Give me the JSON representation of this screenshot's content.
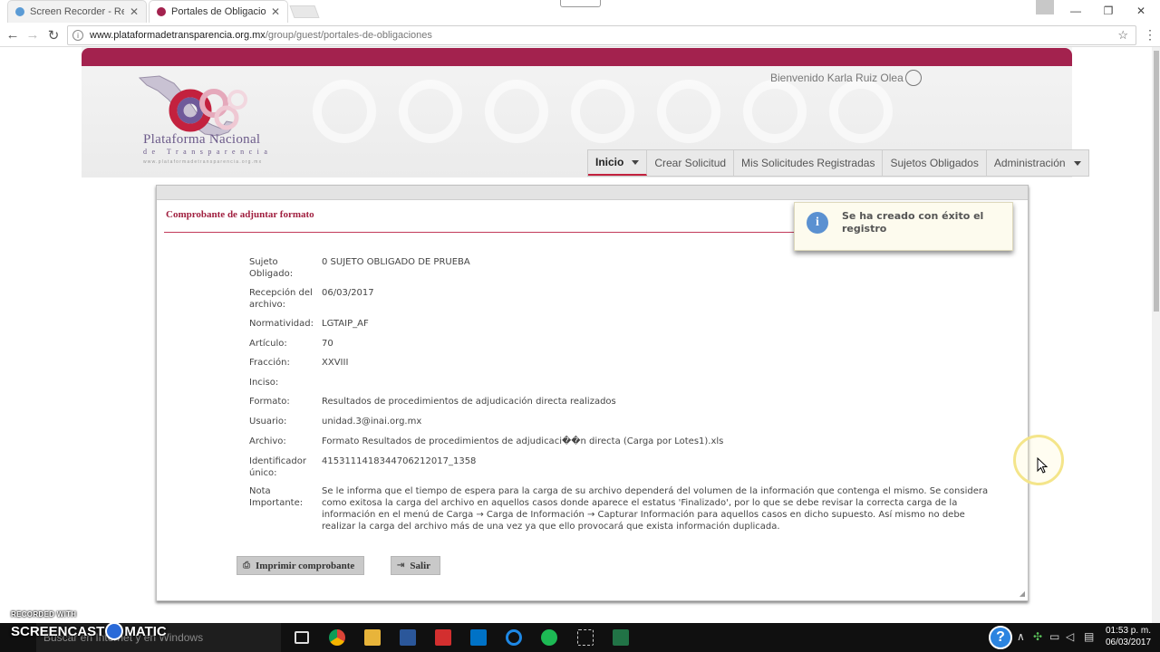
{
  "browser": {
    "tabs": [
      {
        "title": "Screen Recorder - Record"
      },
      {
        "title": "Portales de Obligaciones"
      }
    ],
    "url_host": "www.plataformadetransparencia.org.mx",
    "url_path": "/group/guest/portales-de-obligaciones"
  },
  "header": {
    "logo_title": "Plataforma Nacional",
    "logo_subtitle": "de Transparencia",
    "logo_url": "www.plataformadetransparencia.org.mx",
    "welcome": "Bienvenido Karla Ruiz Olea",
    "nav": [
      {
        "label": "Inicio",
        "active": true,
        "dropdown": true
      },
      {
        "label": "Crear Solicitud"
      },
      {
        "label": "Mis Solicitudes Registradas"
      },
      {
        "label": "Sujetos Obligados"
      },
      {
        "label": "Administración",
        "dropdown": true
      }
    ]
  },
  "panel": {
    "title": "Comprobante de adjuntar formato",
    "fields": [
      {
        "label": "Sujeto Obligado:",
        "value": "0 SUJETO OBLIGADO DE PRUEBA"
      },
      {
        "label": "Recepción del archivo:",
        "value": "06/03/2017"
      },
      {
        "label": "Normatividad:",
        "value": "LGTAIP_AF"
      },
      {
        "label": "Artículo:",
        "value": "70"
      },
      {
        "label": "Fracción:",
        "value": "XXVIII"
      },
      {
        "label": "Inciso:",
        "value": ""
      },
      {
        "label": "Formato:",
        "value": "Resultados de procedimientos de adjudicación directa realizados"
      },
      {
        "label": "Usuario:",
        "value": "unidad.3@inai.org.mx"
      },
      {
        "label": "Archivo:",
        "value": "Formato Resultados de procedimientos de adjudicaci��n directa (Carga por Lotes1).xls"
      },
      {
        "label": "Identificador único:",
        "value": "4153111418344706212017_1358"
      },
      {
        "label": "Nota Importante:",
        "value": "Se le informa que el tiempo de espera para la carga de su archivo dependerá del volumen de la información que contenga el mismo. Se considera como exitosa la carga del archivo en aquellos casos donde aparece el estatus 'Finalizado', por lo que se debe revisar la correcta carga de la información en el menú de Carga → Carga de Información → Capturar Información para aquellos casos en dicho supuesto. Así mismo no debe realizar la carga del archivo más de una vez ya que ello provocará que exista información duplicada."
      }
    ],
    "print_label": "Imprimir comprobante",
    "exit_label": "Salir"
  },
  "toast": {
    "message": "Se ha creado con éxito el registro"
  },
  "recorder": {
    "recorded_with": "RECORDED WITH",
    "brand_a": "SCREENCAST",
    "brand_b": "MATIC"
  },
  "taskbar": {
    "search_placeholder": "Buscar en Internet y en Windows",
    "time": "01:53 p. m.",
    "date": "06/03/2017"
  },
  "colors": {
    "brand": "#a3224e",
    "title": "#a01f3f",
    "info": "#5b91d1"
  }
}
